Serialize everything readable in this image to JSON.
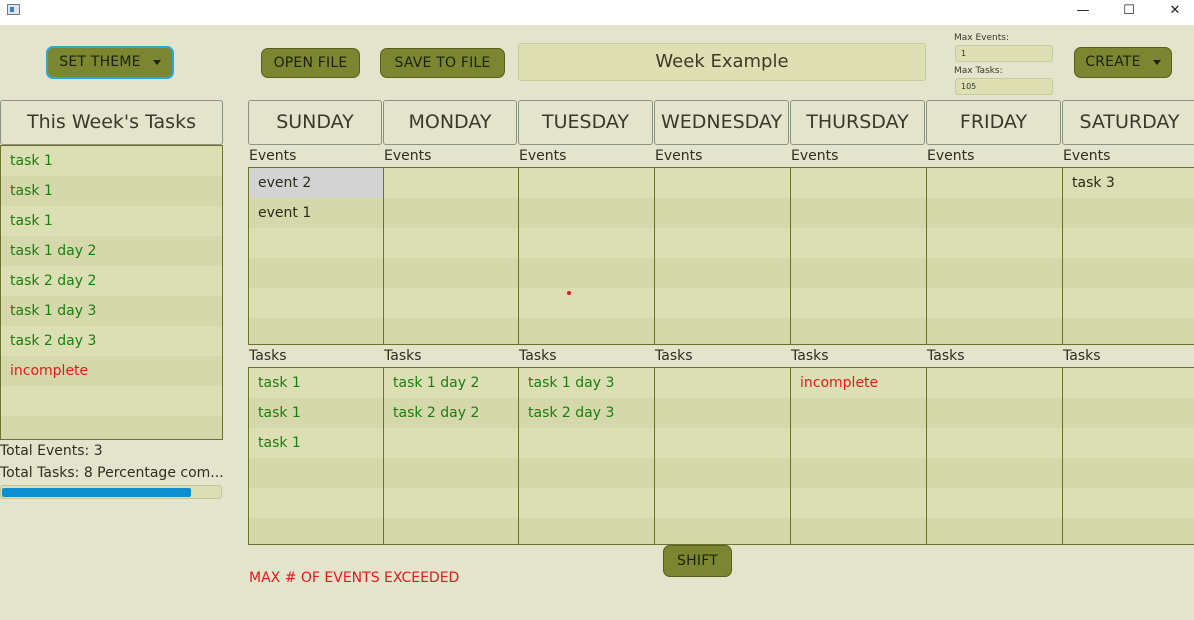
{
  "window": {
    "minimize": "—",
    "maximize": "☐",
    "close": "✕"
  },
  "toolbar": {
    "set_theme": "SET THEME",
    "open_file": "OPEN FILE",
    "save_to_file": "SAVE TO FILE",
    "week_title": "Week Example",
    "max_events_label": "Max Events:",
    "max_events_value": "1",
    "max_tasks_label": "Max Tasks:",
    "max_tasks_value": "105",
    "create": "CREATE"
  },
  "sidebar": {
    "title": "This Week's Tasks",
    "tasks": [
      {
        "label": "task 1",
        "status": "task"
      },
      {
        "label": "task 1",
        "status": "task"
      },
      {
        "label": "task 1",
        "status": "task"
      },
      {
        "label": "task 1 day 2",
        "status": "task"
      },
      {
        "label": "task 2 day 2",
        "status": "task"
      },
      {
        "label": "task 1 day 3",
        "status": "task"
      },
      {
        "label": "task 2 day 3",
        "status": "task"
      },
      {
        "label": "incomplete",
        "status": "incomplete"
      }
    ],
    "total_events": "Total Events: 3",
    "total_tasks": "Total Tasks: 8 Percentage com...",
    "progress": 0.86
  },
  "labels": {
    "events": "Events",
    "tasks": "Tasks"
  },
  "days": [
    {
      "name": "SUNDAY",
      "events": [
        "event 2",
        "event 1"
      ],
      "tasks": [
        {
          "label": "task 1",
          "status": "task"
        },
        {
          "label": "task 1",
          "status": "task"
        },
        {
          "label": "task 1",
          "status": "task"
        }
      ]
    },
    {
      "name": "MONDAY",
      "events": [],
      "tasks": [
        {
          "label": "task 1 day 2",
          "status": "task"
        },
        {
          "label": "task 2 day 2",
          "status": "task"
        }
      ]
    },
    {
      "name": "TUESDAY",
      "events": [],
      "tasks": [
        {
          "label": "task 1 day 3",
          "status": "task"
        },
        {
          "label": "task 2 day 3",
          "status": "task"
        }
      ]
    },
    {
      "name": "WEDNESDAY",
      "events": [],
      "tasks": []
    },
    {
      "name": "THURSDAY",
      "events": [],
      "tasks": [
        {
          "label": "incomplete",
          "status": "incomplete"
        }
      ]
    },
    {
      "name": "FRIDAY",
      "events": [],
      "tasks": []
    },
    {
      "name": "SATURDAY",
      "events": [
        "task 3"
      ],
      "tasks": []
    }
  ],
  "shift": "SHIFT",
  "warning": "MAX # OF EVENTS EXCEEDED",
  "colors": {
    "background": "#e3e4cc",
    "button": "#7b8631",
    "list": "#dcdfb3",
    "task": "#1c7d10",
    "incomplete": "#e81818",
    "progress": "#0b8fd0"
  }
}
